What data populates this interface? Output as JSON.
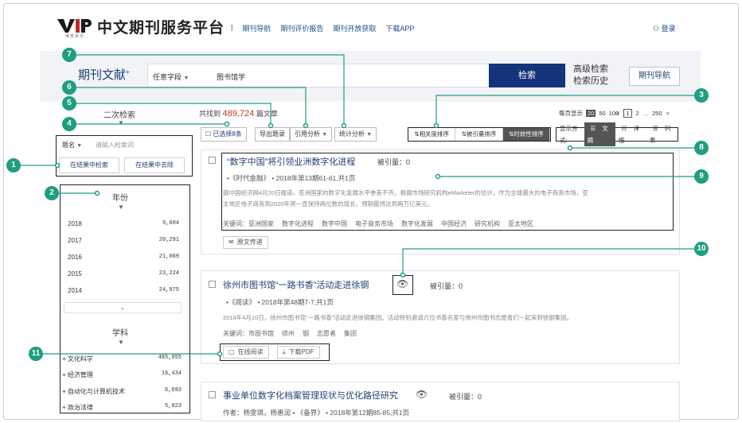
{
  "header": {
    "logo_text": "VIP",
    "logo_sub": "维普资讯",
    "title": "中文期刊服务平台",
    "nav": [
      "期刊导航",
      "期刊评价报告",
      "期刊开放获取",
      "下载APP"
    ],
    "login": "登录"
  },
  "search": {
    "brand": "期刊文献",
    "brand_sup": "+",
    "field": "任意字段",
    "query": "图书馆学",
    "button": "检索",
    "advanced": "高级检索",
    "history": "检索历史",
    "journal_nav": "期刊导航"
  },
  "sidebar": {
    "secondary_label": "二次检索",
    "field": "题名",
    "input_placeholder": "请输入检索词",
    "btn_within": "在结果中检索",
    "btn_exclude": "在结果中去除",
    "year_title": "年份",
    "years": [
      {
        "label": "2018",
        "count": "9,604"
      },
      {
        "label": "2017",
        "count": "20,291"
      },
      {
        "label": "2016",
        "count": "21,069"
      },
      {
        "label": "2015",
        "count": "23,224"
      },
      {
        "label": "2014",
        "count": "24,975"
      }
    ],
    "subject_title": "学科",
    "subjects": [
      {
        "label": "文化科学",
        "count": "485,955"
      },
      {
        "label": "经济管理",
        "count": "16,434"
      },
      {
        "label": "自动化与计算机技术",
        "count": "6,693"
      },
      {
        "label": "政治法律",
        "count": "5,023"
      }
    ]
  },
  "results_bar": {
    "found_prefix": "共找到",
    "found_count": "489,724",
    "found_suffix": "篇文章",
    "selected": "已选择8条",
    "export": "导出题录",
    "citation": "引用分析",
    "stats": "统计分析",
    "sort": [
      "相关度排序",
      "被引量排序",
      "时效性排序"
    ],
    "per_page_label": "每页显示",
    "per_page": [
      "20",
      "50",
      "100"
    ],
    "pager": [
      "1",
      "2",
      "...",
      "250",
      ">"
    ],
    "display_label": "显示方式:",
    "display": [
      "文摘",
      "详细",
      "列表"
    ]
  },
  "results": [
    {
      "title": "“数字中国”将引领业洲数字化进程",
      "cite": "被引量：0",
      "source": "•《时代金融》 • 2018年第13期61-61,共1页",
      "abstract_1": "据中国经济网4月20日报道，亚洲国家的数字化发展水平参差不齐。根据市场研究机构eMarketer的估计，作为全球最大的电子商务市场，亚",
      "abstract_2": "太地区电子商务到2020年将一直保持两位数的增长，预期最将达到两万亿美元。",
      "keywords_label": "关键词：",
      "keywords": [
        "亚洲国家",
        "数字化进程",
        "数字中国",
        "电子商务市场",
        "数字化发展",
        "中国经济",
        "研究机构",
        "亚太地区"
      ],
      "action": "原文传递"
    },
    {
      "title": "徐州市图书馆“一路书香”活动走进徐钢",
      "cite": "被引量：0",
      "source": "•《阅读》 • 2018年第48期7-7,共1页",
      "abstract_1": "2018年4月10日，徐州市图书馆“一路书香”活动走进徐钢集团。活动特别邀请六位书香名家与徐州市图书志愿者们一起来到徐钢集团。",
      "keywords_label": "关键词：",
      "keywords": [
        "市图书馆",
        "徐州",
        "钢",
        "志愿者",
        "集团"
      ],
      "action_read": "在线阅读",
      "action_pdf": "下载PDF"
    },
    {
      "title": "事业单位数字化档案管理现状与优化路径研究",
      "cite": "被引量：0",
      "source": "作者：杨雯琪，杨惠润 • 《备界》 • 2018年第12期85-85,共1页"
    }
  ],
  "callouts": [
    "1",
    "2",
    "3",
    "4",
    "5",
    "6",
    "7",
    "8",
    "9",
    "10",
    "11"
  ],
  "colors": {
    "callout": "#1f9e80",
    "primary": "#13347a",
    "count_red": "#c0392b"
  }
}
